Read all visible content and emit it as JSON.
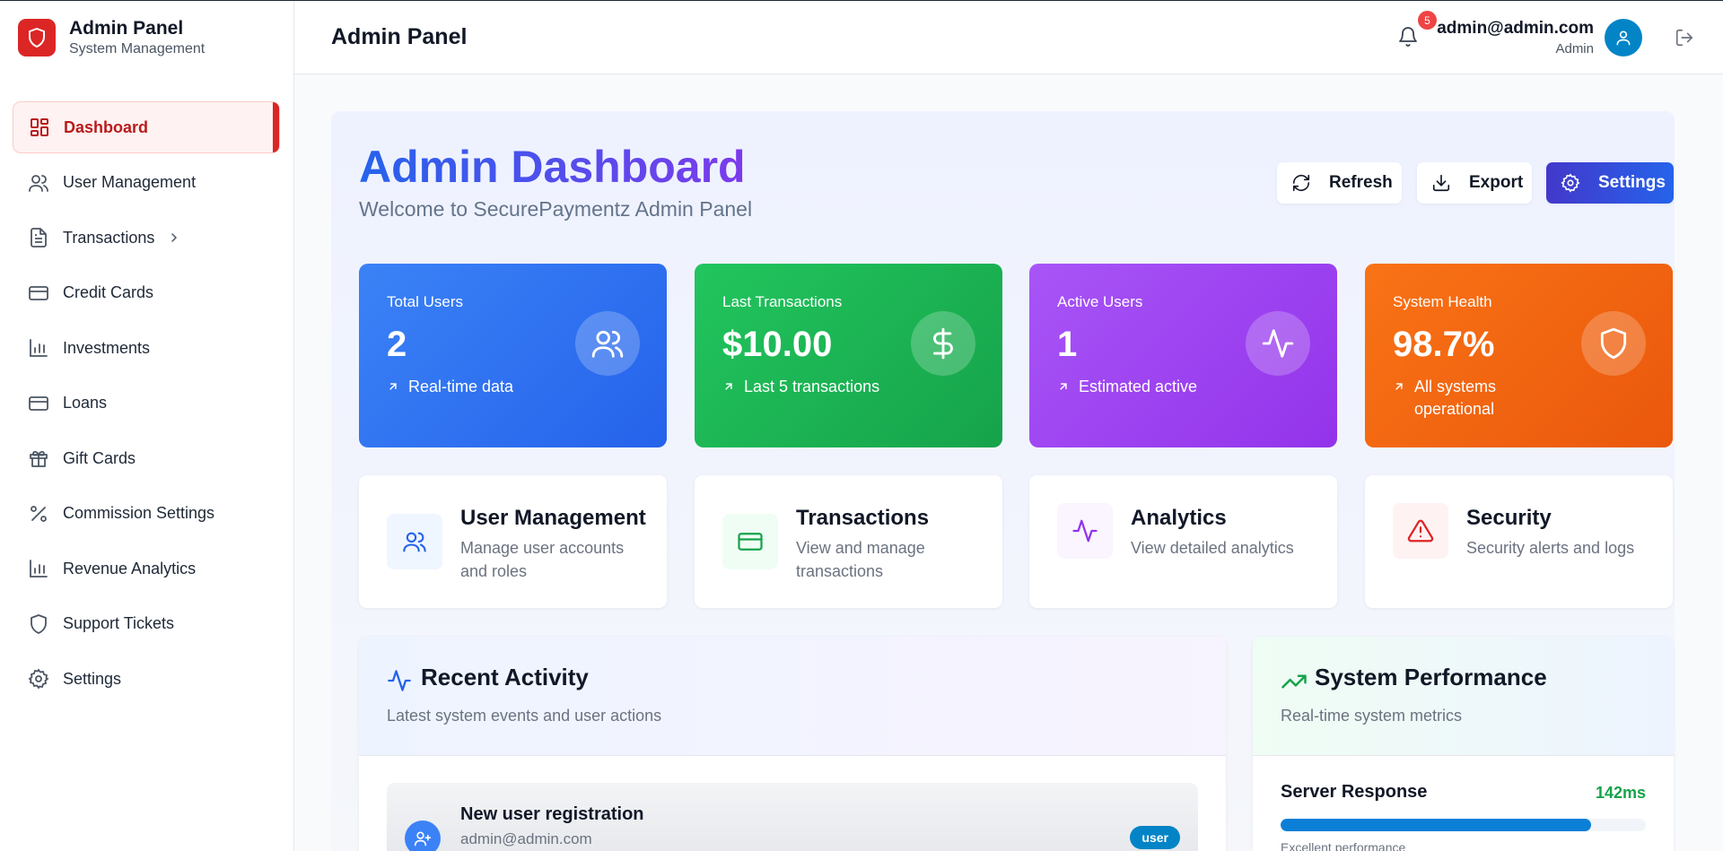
{
  "brand": {
    "title": "Admin Panel",
    "subtitle": "System Management"
  },
  "sidebar": {
    "items": [
      {
        "label": "Dashboard",
        "icon": "dashboard-icon",
        "active": true
      },
      {
        "label": "User Management",
        "icon": "users-icon"
      },
      {
        "label": "Transactions",
        "icon": "document-icon",
        "has_submenu": true
      },
      {
        "label": "Credit Cards",
        "icon": "credit-card-icon"
      },
      {
        "label": "Investments",
        "icon": "bar-chart-icon"
      },
      {
        "label": "Loans",
        "icon": "credit-card-icon"
      },
      {
        "label": "Gift Cards",
        "icon": "gift-icon"
      },
      {
        "label": "Commission Settings",
        "icon": "percent-icon"
      },
      {
        "label": "Revenue Analytics",
        "icon": "bar-chart-icon"
      },
      {
        "label": "Support Tickets",
        "icon": "shield-icon"
      },
      {
        "label": "Settings",
        "icon": "gear-icon"
      }
    ]
  },
  "header": {
    "title": "Admin Panel",
    "notifications_count": "5",
    "user_email": "admin@admin.com",
    "user_role": "Admin"
  },
  "dashboard": {
    "title": "Admin Dashboard",
    "subtitle": "Welcome to SecurePaymentz Admin Panel",
    "buttons": {
      "refresh": "Refresh",
      "export": "Export",
      "settings": "Settings"
    }
  },
  "stats": [
    {
      "label": "Total Users",
      "value": "2",
      "note": "Real-time data",
      "color": "#2563eb"
    },
    {
      "label": "Last Transactions",
      "value": "$10.00",
      "note": "Last 5 transactions",
      "color": "#16a34a"
    },
    {
      "label": "Active Users",
      "value": "1",
      "note": "Estimated active",
      "color": "#9333ea"
    },
    {
      "label": "System Health",
      "value": "98.7%",
      "note": "All systems operational",
      "color": "#ea580c"
    }
  ],
  "quick_actions": [
    {
      "title": "User Management",
      "description": "Manage user accounts and roles"
    },
    {
      "title": "Transactions",
      "description": "View and manage transactions"
    },
    {
      "title": "Analytics",
      "description": "View detailed analytics"
    },
    {
      "title": "Security",
      "description": "Security alerts and logs"
    }
  ],
  "recent_activity": {
    "title": "Recent Activity",
    "subtitle": "Latest system events and user actions",
    "items": [
      {
        "title": "New user registration",
        "subtitle": "admin@admin.com",
        "badge": "user"
      }
    ]
  },
  "system_performance": {
    "title": "System Performance",
    "subtitle": "Real-time system metrics",
    "metrics": [
      {
        "label": "Server Response",
        "value": "142ms",
        "progress": 0.85,
        "note": "Excellent performance"
      }
    ]
  }
}
